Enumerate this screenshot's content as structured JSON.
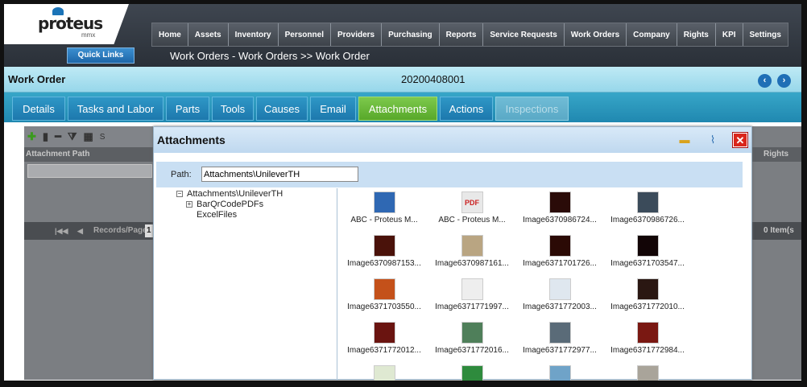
{
  "app": {
    "logo": "proteus",
    "logo_sub": "mmx",
    "quick_links": "Quick Links",
    "breadcrumb": "Work Orders - Work Orders >> Work Order"
  },
  "nav": [
    "Home",
    "Assets",
    "Inventory",
    "Personnel",
    "Providers",
    "Purchasing",
    "Reports",
    "Service Requests",
    "Work Orders",
    "Company",
    "Rights",
    "KPI",
    "Settings"
  ],
  "record": {
    "title": "Work Order",
    "number": "20200408001"
  },
  "tabs": [
    "Details",
    "Tasks and Labor",
    "Parts",
    "Tools",
    "Causes",
    "Email",
    "Attachments",
    "Actions",
    "Inspections"
  ],
  "active_tab": "Attachments",
  "grid": {
    "toolbar_fragment": "S",
    "column": "Attachment Path",
    "right_column": "Rights",
    "pager_label": "Records/Page",
    "pager_value_fragment": "1",
    "items_fragment": "0 Item(s"
  },
  "modal": {
    "title": "Attachments",
    "path_label": "Path:",
    "path_value": "Attachments\\UnileverTH",
    "tree": {
      "root": "Attachments\\UnileverTH",
      "children": [
        "BarQrCodePDFs",
        "ExcelFiles"
      ]
    },
    "files": [
      {
        "name": "ABC - Proteus M...",
        "color": "#2f68b3",
        "kind": "doc"
      },
      {
        "name": "ABC - Proteus M...",
        "color": "#e8e8e8",
        "kind": "pdf"
      },
      {
        "name": "Image6370986724...",
        "color": "#2a0b08"
      },
      {
        "name": "Image6370986726...",
        "color": "#3b4b5a"
      },
      {
        "name": "Image6370987153...",
        "color": "#4a120a"
      },
      {
        "name": "Image6370987161...",
        "color": "#b9a582"
      },
      {
        "name": "Image6371701726...",
        "color": "#2b0a05"
      },
      {
        "name": "Image6371703547...",
        "color": "#120506"
      },
      {
        "name": "Image6371703550...",
        "color": "#c4511a"
      },
      {
        "name": "Image6371771997...",
        "color": "#eeeeee"
      },
      {
        "name": "Image6371772003...",
        "color": "#dfe7ef"
      },
      {
        "name": "Image6371772010...",
        "color": "#2a1712"
      },
      {
        "name": "Image6371772012...",
        "color": "#6a1410"
      },
      {
        "name": "Image6371772016...",
        "color": "#4f7f5a"
      },
      {
        "name": "Image6371772977...",
        "color": "#5a6b78"
      },
      {
        "name": "Image6371772984...",
        "color": "#7a1812"
      }
    ]
  }
}
